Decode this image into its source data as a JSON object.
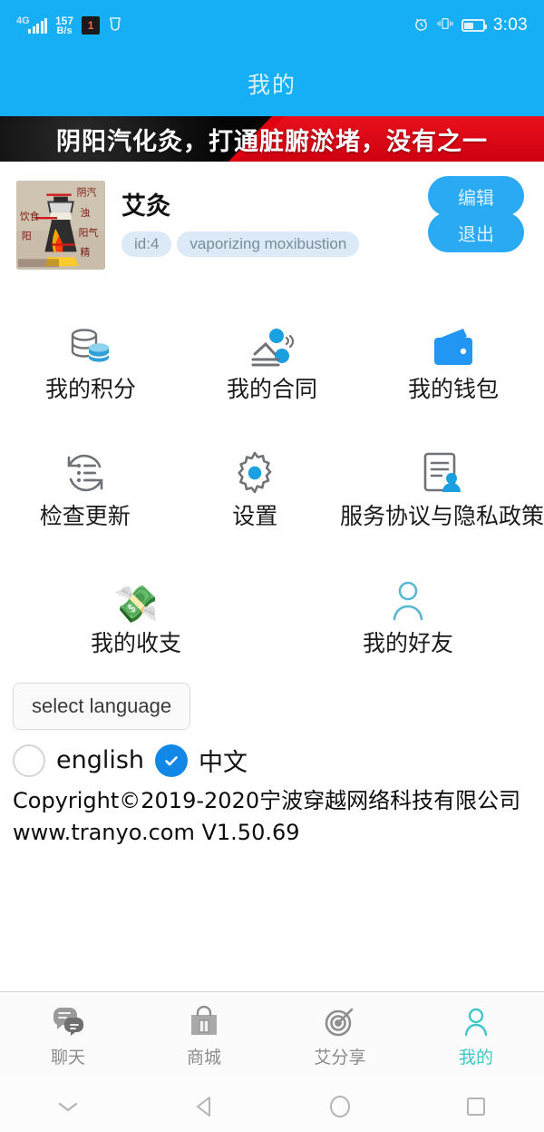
{
  "statusbar": {
    "network_type": "4G",
    "data_rate_value": "157",
    "data_rate_unit": "B/s",
    "notif_badge": "1",
    "clock": "3:03",
    "icons": [
      "signal-icon",
      "notification-icon",
      "shield-icon",
      "alarm-icon",
      "vibrate-icon",
      "battery-icon"
    ]
  },
  "appbar": {
    "title": "我的"
  },
  "banner": {
    "text": "阴阳汽化灸，打通脏腑淤堵，没有之一"
  },
  "profile": {
    "avatar_alt": "vaporizing-moxibustion-kettle",
    "name": "艾灸",
    "tags": [
      "id:4",
      "vaporizing moxibustion"
    ],
    "edit_label": "编辑",
    "logout_label": "退出"
  },
  "menu": {
    "rows": [
      [
        {
          "label": "我的积分",
          "icon": "database-coins-icon"
        },
        {
          "label": "我的合同",
          "icon": "contract-person-icon"
        },
        {
          "label": "我的钱包",
          "icon": "wallet-icon"
        }
      ],
      [
        {
          "label": "检查更新",
          "icon": "refresh-list-icon"
        },
        {
          "label": "设置",
          "icon": "gear-icon"
        },
        {
          "label": "服务协议与隐私政策",
          "icon": "document-person-icon"
        }
      ],
      [
        {
          "label": "我的收支",
          "icon": "money-hand-icon",
          "glyph": "💸"
        },
        {
          "label": "我的好友",
          "icon": "person-outline-icon"
        }
      ]
    ]
  },
  "language": {
    "button_label": "select language",
    "options": [
      {
        "label": "english",
        "selected": false
      },
      {
        "label": "中文",
        "selected": true
      }
    ]
  },
  "footer": {
    "copyright": "Copyright©2019-2020宁波穿越网络科技有限公司",
    "site_version": "www.tranyo.com V1.50.69"
  },
  "tabbar": {
    "items": [
      {
        "label": "聊天",
        "icon": "chat-icon",
        "active": false
      },
      {
        "label": "商城",
        "icon": "shop-bag-icon",
        "active": false
      },
      {
        "label": "艾分享",
        "icon": "target-icon",
        "active": false
      },
      {
        "label": "我的",
        "icon": "person-icon",
        "active": true
      }
    ]
  },
  "navbar": {
    "items": [
      "hide-keyboard-icon",
      "back-icon",
      "home-icon",
      "recents-icon"
    ]
  },
  "colors": {
    "brand_blue": "#16AEF5",
    "button_blue": "#29AAF3",
    "banner_red": "#e2000f",
    "banner_black": "#050505",
    "tab_active": "#3fc6c6",
    "radio_checked": "#1288e6"
  }
}
